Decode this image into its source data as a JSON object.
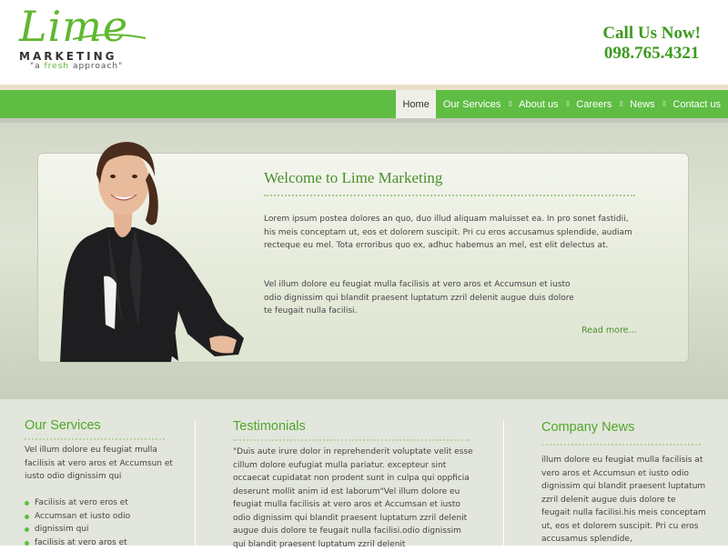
{
  "header": {
    "logo_word": "Lime",
    "logo_sub": "MARKETING",
    "logo_tag_pre": "\"a ",
    "logo_tag_accent": "fresh",
    "logo_tag_post": " approach\"",
    "call_title": "Call Us Now!",
    "call_phone": "098.765.4321"
  },
  "nav": {
    "items": [
      "Home",
      "Our Services",
      "About us",
      "Careers",
      "News",
      "Contact us"
    ],
    "active_index": 0
  },
  "hero": {
    "title": "Welcome to Lime Marketing",
    "paragraph1": "Lorem ipsum postea dolores an quo, duo illud aliquam maluisset ea. In pro sonet fastidii, his meis conceptam ut, eos et dolorem suscipit. Pri cu eros accusamus splendide, audiam recteque eu mel. Tota erroribus quo ex, adhuc habemus an mel, est elit delectus at.",
    "paragraph2": "Vel illum dolore eu feugiat mulla facilisis at vero aros et Accumsun et iusto odio dignissim qui blandit praesent luptatum zzril delenit augue duis dolore te feugait nulla facilisi.",
    "read_more": "Read more..."
  },
  "services": {
    "title": "Our Services",
    "intro": "Vel illum dolore eu feugiat mulla facilisis at vero aros et Accumsun et iusto odio dignissim qui",
    "bullets": [
      "Facilisis at vero eros et",
      "Accumsan et iusto odio",
      "dignissim qui",
      "facilisis at vero aros et"
    ]
  },
  "testimonials": {
    "title": "Testimonials",
    "text": "\"Duis aute irure dolor in reprehenderit voluptate velit esse cillum dolore eufugiat mulla pariatur. excepteur sint occaecat cupidatat non prodent sunt in culpa qui oppficia deserunt mollit anim id est laborum\"Vel illum dolore eu feugiat mulla facilisis at vero aros et Accumsan et iusto odio dignissim qui blandit praesent luptatum zzril delenit augue duis dolore te feugait nulla facilisi.odio dignissim qui blandit praesent luptatum zzril delenit"
  },
  "news": {
    "title": "Company News",
    "text": "illum dolore eu feugiat mulla facilisis at vero aros et Accumsun et iusto odio dignissim qui blandit praesent luptatum zzril delenit augue duis dolore te feugait nulla facilisi.his meis conceptam ut, eos et dolorem suscipit. Pri cu eros accusamus splendide,"
  },
  "colors": {
    "brand_green": "#5fbd44",
    "heading_green": "#4fa82b",
    "call_green": "#3d9a1e"
  }
}
